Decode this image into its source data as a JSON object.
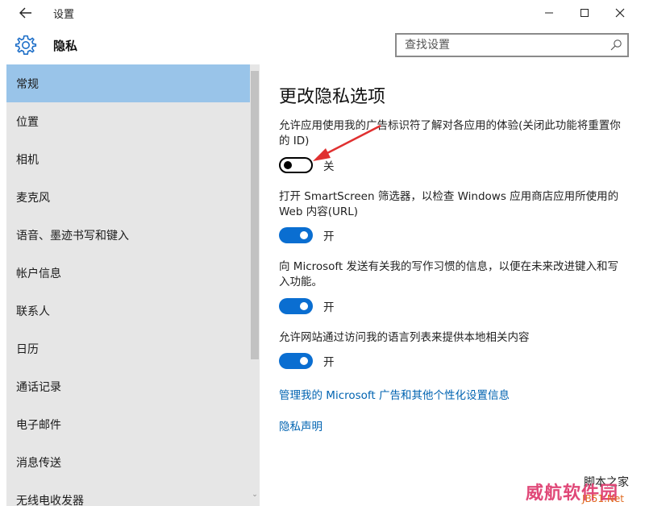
{
  "window": {
    "title": "设置",
    "controls": {
      "minimize": "—",
      "maximize": "☐",
      "close": "✕"
    }
  },
  "header": {
    "title": "隐私",
    "search_placeholder": "查找设置"
  },
  "sidebar": {
    "items": [
      {
        "label": "常规",
        "active": true
      },
      {
        "label": "位置"
      },
      {
        "label": "相机"
      },
      {
        "label": "麦克风"
      },
      {
        "label": "语音、墨迹书写和键入"
      },
      {
        "label": "帐户信息"
      },
      {
        "label": "联系人"
      },
      {
        "label": "日历"
      },
      {
        "label": "通话记录"
      },
      {
        "label": "电子邮件"
      },
      {
        "label": "消息传送"
      },
      {
        "label": "无线电收发器"
      }
    ]
  },
  "main": {
    "title": "更改隐私选项",
    "settings": [
      {
        "description": "允许应用使用我的广告标识符了解对各应用的体验(关闭此功能将重置你的 ID)",
        "state": "关",
        "on": false
      },
      {
        "description": "打开 SmartScreen 筛选器，以检查 Windows 应用商店应用所使用的 Web 内容(URL)",
        "state": "开",
        "on": true
      },
      {
        "description": "向 Microsoft 发送有关我的写作习惯的信息，以便在未来改进键入和写入功能。",
        "state": "开",
        "on": true
      },
      {
        "description": "允许网站通过访问我的语言列表来提供本地相关内容",
        "state": "开",
        "on": true
      }
    ],
    "links": {
      "manage_ads": "管理我的 Microsoft 广告和其他个性化设置信息",
      "privacy_statement": "隐私声明"
    }
  },
  "watermark": {
    "top": "脚本之家",
    "main": "威航软件园",
    "site": "JB51.Net"
  },
  "colors": {
    "accent": "#0a6ed1",
    "sidebar_bg": "#e6e6e6",
    "sidebar_active": "#99c4e9",
    "link": "#0063b1",
    "annotation_arrow": "#e03030"
  }
}
